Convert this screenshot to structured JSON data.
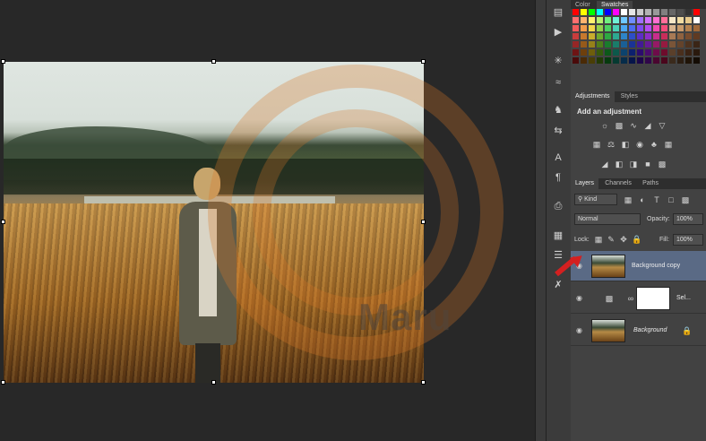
{
  "panels": {
    "color_tabs": [
      "Color",
      "Swatches"
    ],
    "adjustments_tabs": [
      "Adjustments",
      "Styles"
    ],
    "adjustments_title": "Add an adjustment",
    "layers_tabs": [
      "Layers",
      "Channels",
      "Paths"
    ],
    "filter_kind": "Kind",
    "blend_mode": "Normal",
    "opacity_label": "Opacity:",
    "opacity_value": "100%",
    "lock_label": "Lock:",
    "fill_label": "Fill:",
    "fill_value": "100%"
  },
  "layers": [
    {
      "name": "Background copy",
      "selected": true
    },
    {
      "name": "Sel...",
      "selected": false
    },
    {
      "name": "Background",
      "selected": false
    }
  ],
  "watermark": {
    "text": "Maru"
  },
  "colors": {
    "accent_selected": "#5a6a85",
    "arrow": "#d42020"
  },
  "tools": [
    "history-icon",
    "play-icon",
    "brush-settings-icon",
    "brush-presets-icon",
    "clone-source-icon",
    "adjust-icon",
    "character-icon",
    "paragraph-icon",
    "paste-icon",
    "notes-icon",
    "document-icon",
    "tools-icon"
  ]
}
